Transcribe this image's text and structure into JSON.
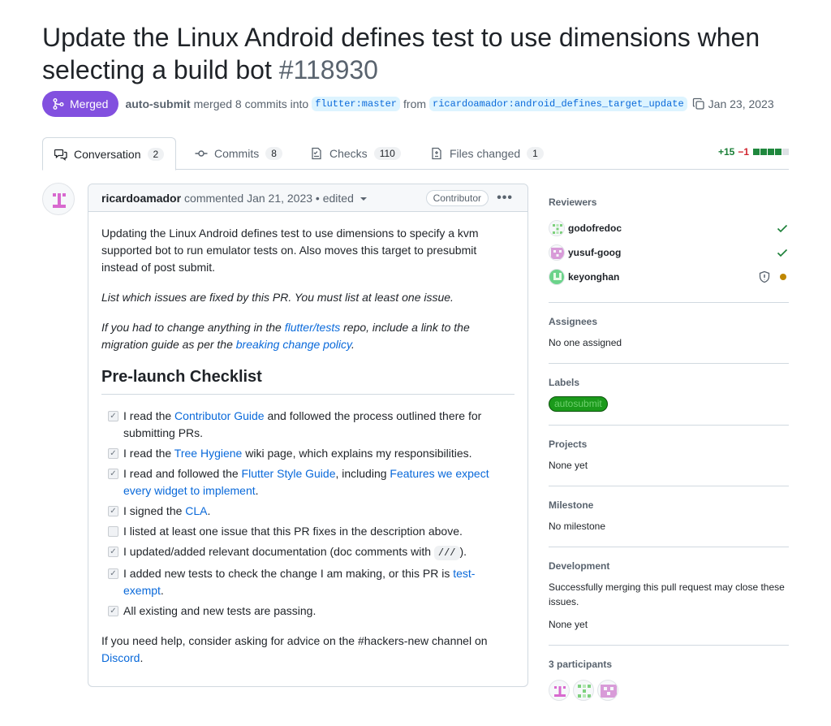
{
  "pr": {
    "title": "Update the Linux Android defines test to use dimensions when selecting a build bot",
    "number": "#118930",
    "status": "Merged",
    "author": "auto-submit",
    "merge_text": "merged 8 commits into",
    "base_branch": "flutter:master",
    "from_text": "from",
    "head_branch": "ricardoamador:android_defines_target_update",
    "date": "Jan 23, 2023"
  },
  "tabs": [
    {
      "label": "Conversation",
      "count": "2"
    },
    {
      "label": "Commits",
      "count": "8"
    },
    {
      "label": "Checks",
      "count": "110"
    },
    {
      "label": "Files changed",
      "count": "1"
    }
  ],
  "diffstat": {
    "additions": "+15",
    "deletions": "−1"
  },
  "comment": {
    "author": "ricardoamador",
    "action": "commented Jan 21, 2023 • edited",
    "badge": "Contributor",
    "menu": "•••",
    "intro": "Updating the Linux Android defines test to use dimensions to specify a kvm supported bot to run emulator tests on. Also moves this target to presubmit instead of post submit.",
    "issues_note": "List which issues are fixed by this PR. You must list at least one issue.",
    "change_note_1": "If you had to change anything in the ",
    "change_note_link_1": "flutter/tests",
    "change_note_2": " repo, include a link to the migration guide as per the ",
    "change_note_link_2": "breaking change policy",
    "change_note_3": ".",
    "checklist_heading": "Pre-launch Checklist",
    "checklist": [
      {
        "checked": true,
        "parts": [
          {
            "t": "I read the "
          },
          {
            "t": "Contributor Guide",
            "link": true
          },
          {
            "t": " and followed the process outlined there for submitting PRs."
          }
        ]
      },
      {
        "checked": true,
        "parts": [
          {
            "t": "I read the "
          },
          {
            "t": "Tree Hygiene",
            "link": true
          },
          {
            "t": " wiki page, which explains my responsibilities."
          }
        ]
      },
      {
        "checked": true,
        "parts": [
          {
            "t": "I read and followed the "
          },
          {
            "t": "Flutter Style Guide",
            "link": true
          },
          {
            "t": ", including "
          },
          {
            "t": "Features we expect every widget to implement",
            "link": true
          },
          {
            "t": "."
          }
        ]
      },
      {
        "checked": true,
        "parts": [
          {
            "t": "I signed the "
          },
          {
            "t": "CLA",
            "link": true
          },
          {
            "t": "."
          }
        ]
      },
      {
        "checked": false,
        "parts": [
          {
            "t": "I listed at least one issue that this PR fixes in the description above."
          }
        ]
      },
      {
        "checked": true,
        "parts": [
          {
            "t": "I updated/added relevant documentation (doc comments with "
          },
          {
            "t": "///",
            "code": true
          },
          {
            "t": ")."
          }
        ]
      },
      {
        "checked": true,
        "parts": [
          {
            "t": "I added new tests to check the change I am making, or this PR is "
          },
          {
            "t": "test-exempt",
            "link": true
          },
          {
            "t": "."
          }
        ]
      },
      {
        "checked": true,
        "parts": [
          {
            "t": "All existing and new tests are passing."
          }
        ]
      }
    ],
    "help_1": "If you need help, consider asking for advice on the #hackers-new channel on ",
    "help_link": "Discord",
    "help_2": "."
  },
  "sidebar": {
    "reviewers_title": "Reviewers",
    "reviewers": [
      {
        "name": "godofredoc",
        "state": "approved"
      },
      {
        "name": "yusuf-goog",
        "state": "approved"
      },
      {
        "name": "keyonghan",
        "state": "pending"
      }
    ],
    "assignees_title": "Assignees",
    "assignees_value": "No one assigned",
    "labels_title": "Labels",
    "label": "autosubmit",
    "projects_title": "Projects",
    "projects_value": "None yet",
    "milestone_title": "Milestone",
    "milestone_value": "No milestone",
    "development_title": "Development",
    "development_text": "Successfully merging this pull request may close these issues.",
    "development_value": "None yet",
    "participants_title": "3 participants"
  },
  "colors": {
    "merged": "#8250df",
    "link": "#0969da",
    "approved": "#1a7f37",
    "pending": "#bf8700",
    "label_bg": "#1b9a1b"
  }
}
